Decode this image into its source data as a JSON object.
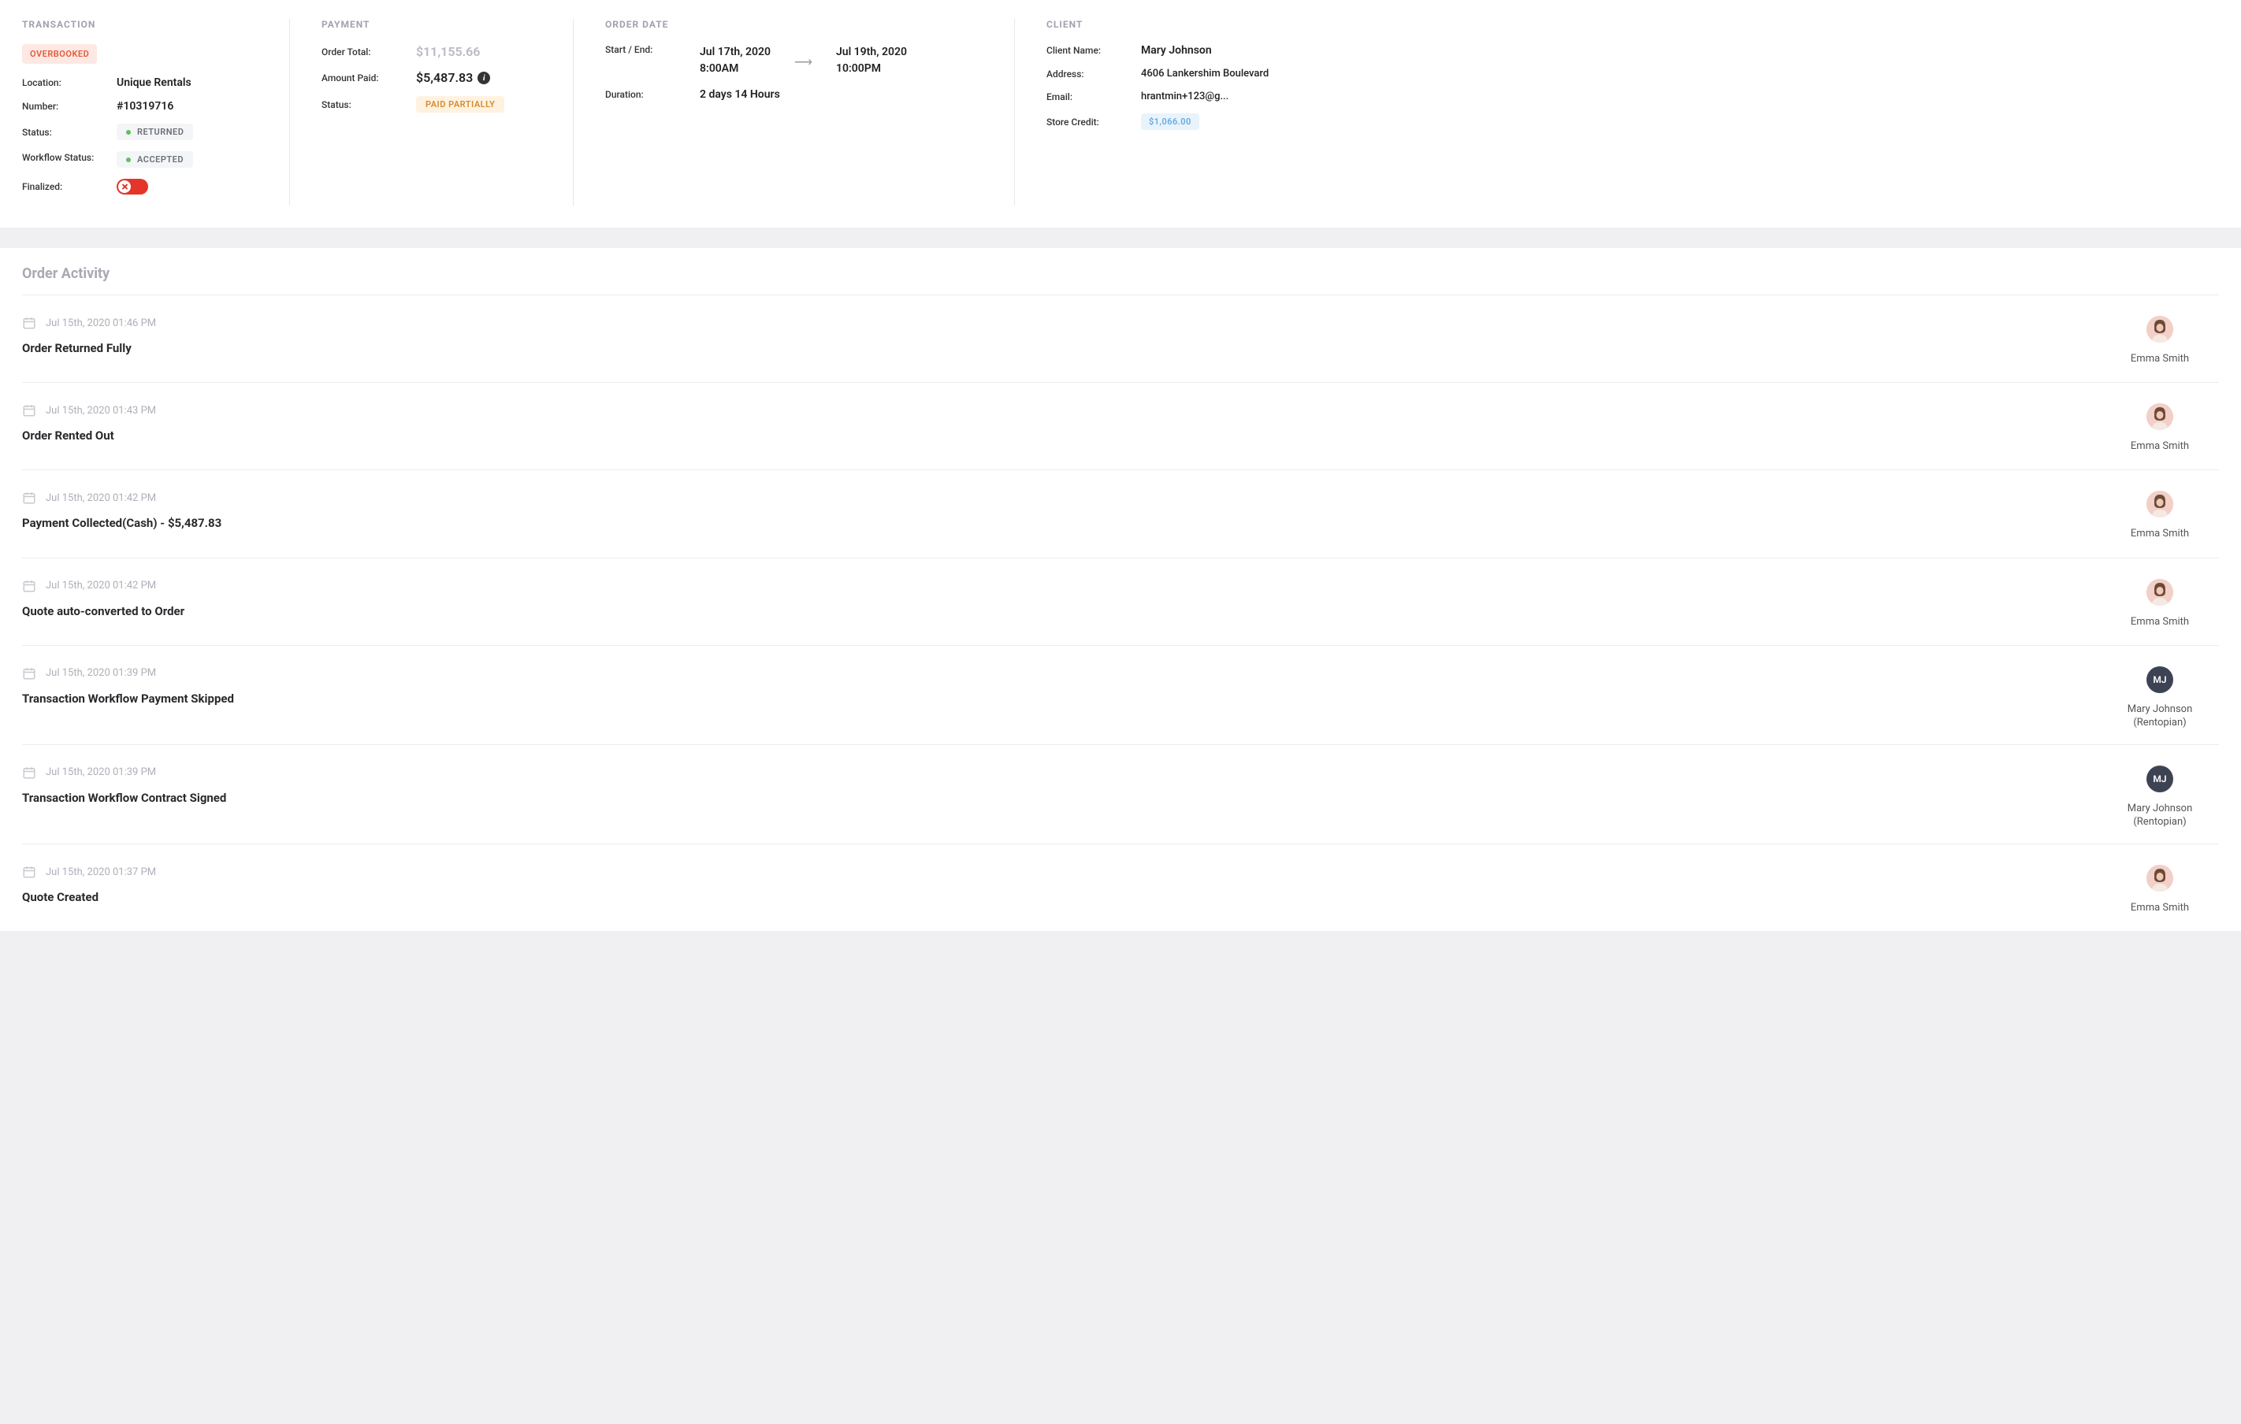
{
  "transaction": {
    "header": "TRANSACTION",
    "overbooked_badge": "OVERBOOKED",
    "location_label": "Location:",
    "location_value": "Unique Rentals",
    "number_label": "Number:",
    "number_value": "#10319716",
    "status_label": "Status:",
    "status_value": "RETURNED",
    "workflow_label": "Workflow Status:",
    "workflow_value": "ACCEPTED",
    "finalized_label": "Finalized:"
  },
  "payment": {
    "header": "PAYMENT",
    "order_total_label": "Order Total:",
    "order_total_value": "$11,155.66",
    "amount_paid_label": "Amount Paid:",
    "amount_paid_value": "$5,487.83",
    "status_label": "Status:",
    "status_value": "PAID PARTIALLY"
  },
  "order_date": {
    "header": "ORDER DATE",
    "start_end_label": "Start / End:",
    "start_date": "Jul 17th, 2020",
    "start_time": "8:00AM",
    "end_date": "Jul 19th, 2020",
    "end_time": "10:00PM",
    "duration_label": "Duration:",
    "duration_value": "2 days 14 Hours"
  },
  "client": {
    "header": "CLIENT",
    "name_label": "Client Name:",
    "name_value": "Mary Johnson",
    "address_label": "Address:",
    "address_value": "4606 Lankershim Boulevard",
    "email_label": "Email:",
    "email_value": "hrantmin+123@g...",
    "credit_label": "Store Credit:",
    "credit_value": "$1,066.00"
  },
  "activity": {
    "title": "Order Activity",
    "items": [
      {
        "timestamp": "Jul 15th, 2020 01:46 PM",
        "desc": "Order Returned Fully",
        "user": "Emma Smith",
        "sub": "",
        "avatar_type": "photo",
        "initials": ""
      },
      {
        "timestamp": "Jul 15th, 2020 01:43 PM",
        "desc": "Order Rented Out",
        "user": "Emma Smith",
        "sub": "",
        "avatar_type": "photo",
        "initials": ""
      },
      {
        "timestamp": "Jul 15th, 2020 01:42 PM",
        "desc": "Payment Collected(Cash) - $5,487.83",
        "user": "Emma Smith",
        "sub": "",
        "avatar_type": "photo",
        "initials": ""
      },
      {
        "timestamp": "Jul 15th, 2020 01:42 PM",
        "desc": "Quote auto-converted to Order",
        "user": "Emma Smith",
        "sub": "",
        "avatar_type": "photo",
        "initials": ""
      },
      {
        "timestamp": "Jul 15th, 2020 01:39 PM",
        "desc": "Transaction Workflow Payment Skipped",
        "user": "Mary Johnson",
        "sub": "(Rentopian)",
        "avatar_type": "initials",
        "initials": "MJ"
      },
      {
        "timestamp": "Jul 15th, 2020 01:39 PM",
        "desc": "Transaction Workflow Contract Signed",
        "user": "Mary Johnson",
        "sub": "(Rentopian)",
        "avatar_type": "initials",
        "initials": "MJ"
      },
      {
        "timestamp": "Jul 15th, 2020 01:37 PM",
        "desc": "Quote Created",
        "user": "Emma Smith",
        "sub": "",
        "avatar_type": "photo",
        "initials": ""
      }
    ]
  }
}
